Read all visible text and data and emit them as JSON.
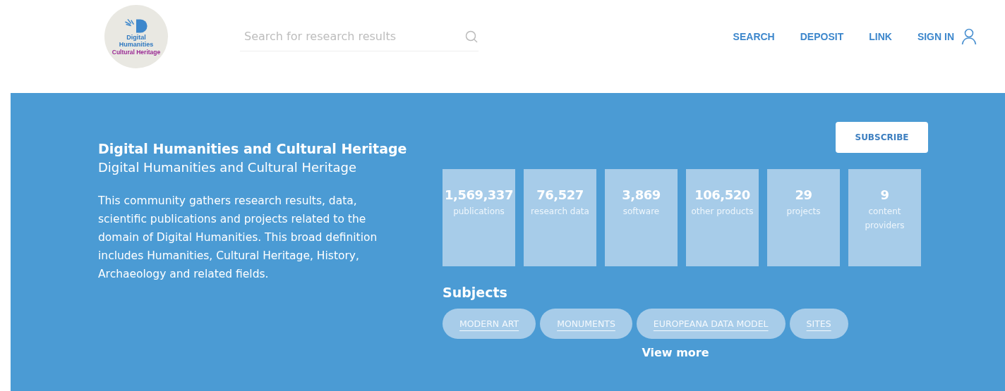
{
  "logo": {
    "lines": [
      "Digital",
      "Humanities",
      "Cultural Heritage"
    ]
  },
  "search": {
    "placeholder": "Search for research results"
  },
  "nav": [
    {
      "label": "SEARCH",
      "kind": "link"
    },
    {
      "label": "DEPOSIT",
      "kind": "link"
    },
    {
      "label": "LINK",
      "kind": "link"
    },
    {
      "label": "SIGN IN",
      "kind": "user"
    }
  ],
  "community": {
    "title": "Digital Humanities and Cultural Heritage",
    "subtitle": "Digital Humanities and Cultural Heritage",
    "description": "This community gathers research results, data, scientific publications and projects related to the domain of Digital Humanities. This broad definition includes Humanities, Cultural Heritage, History, Archaeology and related fields."
  },
  "subscribe": "SUBSCRIBE",
  "stats": [
    {
      "value": "1,569,337",
      "label": "publications"
    },
    {
      "value": "76,527",
      "label": "research data"
    },
    {
      "value": "3,869",
      "label": "software"
    },
    {
      "value": "106,520",
      "label": "other products"
    },
    {
      "value": "29",
      "label": "projects"
    },
    {
      "value": "9",
      "label": "content providers"
    }
  ],
  "subjects": {
    "title": "Subjects",
    "tags": [
      "MODERN ART",
      "MONUMENTS",
      "EUROPEANA DATA MODEL",
      "SITES"
    ],
    "more": "View more"
  }
}
